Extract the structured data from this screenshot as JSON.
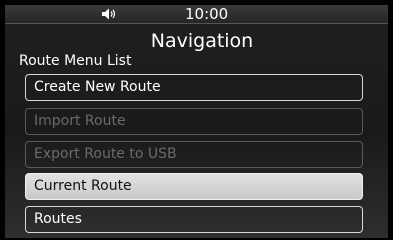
{
  "status": {
    "volume_icon": "speaker-volume-icon",
    "time": "10:00"
  },
  "header": {
    "title": "Navigation"
  },
  "menu": {
    "label": "Route Menu List",
    "items": [
      {
        "label": "Create New Route",
        "state": "enabled"
      },
      {
        "label": "Import Route",
        "state": "disabled"
      },
      {
        "label": "Export Route to USB",
        "state": "disabled"
      },
      {
        "label": "Current Route",
        "state": "selected"
      },
      {
        "label": "Routes",
        "state": "enabled"
      }
    ]
  }
}
